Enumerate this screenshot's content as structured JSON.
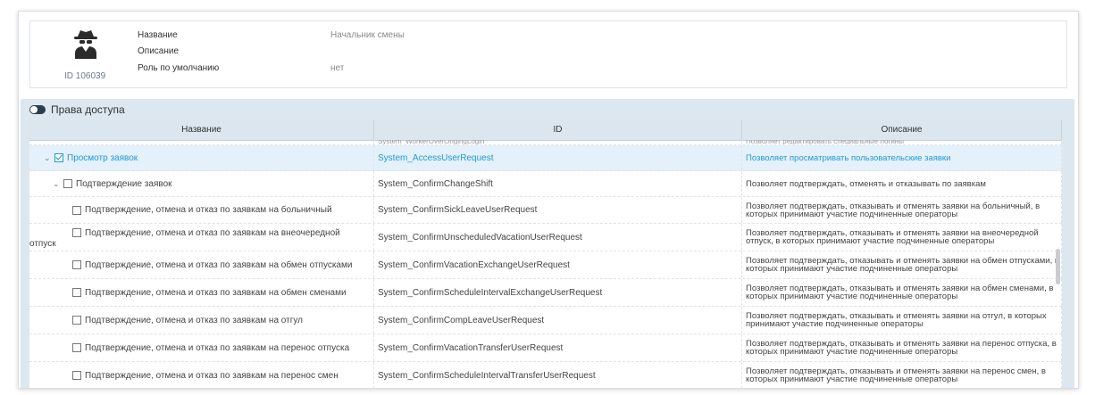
{
  "profile": {
    "id_label": "ID 106039",
    "props": [
      {
        "label": "Название",
        "value": "Начальник смены"
      },
      {
        "label": "Описание",
        "value": ""
      },
      {
        "label": "Роль по умолчанию",
        "value": "нет"
      }
    ]
  },
  "section": {
    "title": "Права доступа",
    "columns": [
      "Название",
      "ID",
      "Описание"
    ],
    "top_partial": {
      "name": "",
      "id": "System_WorkerOverOrigingLogin",
      "desc": "Позволяет редактировать специальные логины"
    },
    "rows": [
      {
        "name": "Просмотр заявок",
        "id": "System_AccessUserRequest",
        "desc": "Позволяет просматривать пользовательские заявки",
        "level": 0,
        "expanded": true,
        "checked": true,
        "selected": true
      },
      {
        "name": "Подтверждение заявок",
        "id": "System_ConfirmChangeShift",
        "desc": "Позволяет подтверждать, отменять и отказывать по заявкам",
        "level": 1,
        "expanded": true,
        "checked": false,
        "selected": false
      },
      {
        "name": "Подтверждение, отмена и отказ по заявкам на больничный",
        "id": "System_ConfirmSickLeaveUserRequest",
        "desc": "Позволяет подтверждать, отказывать и отменять заявки на больничный, в которых принимают участие подчиненные операторы",
        "level": 2,
        "checked": false
      },
      {
        "name": "Подтверждение, отмена и отказ по заявкам на внеочередной",
        "name_wrap": "отпуск",
        "id": "System_ConfirmUnscheduledVacationUserRequest",
        "desc": "Позволяет подтверждать, отказывать и отменять заявки на внеочередной отпуск, в которых принимают участие подчиненные операторы",
        "level": 2,
        "checked": false
      },
      {
        "name": "Подтверждение, отмена и отказ по заявкам на обмен отпусками",
        "id": "System_ConfirmVacationExchangeUserRequest",
        "desc": "Позволяет подтверждать, отказывать и отменять заявки на обмен отпусками, в которых принимают участие подчиненные операторы",
        "level": 2,
        "checked": false
      },
      {
        "name": "Подтверждение, отмена и отказ по заявкам на обмен сменами",
        "id": "System_ConfirmScheduleIntervalExchangeUserRequest",
        "desc": "Позволяет подтверждать, отказывать и отменять заявки на обмен сменами, в которых принимают участие подчиненные операторы",
        "level": 2,
        "checked": false
      },
      {
        "name": "Подтверждение, отмена и отказ по заявкам на отгул",
        "id": "System_ConfirmCompLeaveUserRequest",
        "desc": "Позволяет подтверждать, отказывать и отменять заявки на отгул, в которых принимают участие подчиненные операторы",
        "level": 2,
        "checked": false
      },
      {
        "name": "Подтверждение, отмена и отказ по заявкам на перенос отпуска",
        "id": "System_ConfirmVacationTransferUserRequest",
        "desc": "Позволяет подтверждать, отказывать и отменять заявки на перенос отпуска, в которых принимают участие подчиненные операторы",
        "level": 2,
        "checked": false
      },
      {
        "name": "Подтверждение, отмена и отказ по заявкам на перенос смен",
        "id": "System_ConfirmScheduleIntervalTransferUserRequest",
        "desc": "Позволяет подтверждать, отказывать и отменять заявки на перенос смен, в которых принимают участие подчиненные операторы",
        "level": 2,
        "checked": false
      }
    ]
  },
  "icons": {
    "avatar": "spy-icon",
    "toggle": "toggle-icon",
    "expand": "chevron-down-icon",
    "checkbox": "checkbox-icon"
  },
  "colors": {
    "accent": "#1e9bd7",
    "section_bg": "#dde7ef",
    "selected_row_bg": "#e4f0fa"
  }
}
